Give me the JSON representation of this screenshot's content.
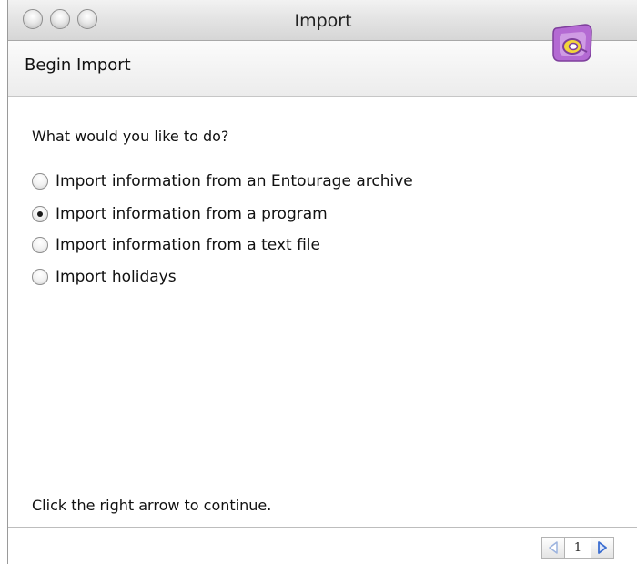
{
  "window": {
    "title": "Import"
  },
  "header": {
    "title": "Begin Import",
    "logo_icon": "entourage-logo-icon"
  },
  "content": {
    "question": "What would you like to do?",
    "options": [
      {
        "label": "Import information from an Entourage archive",
        "selected": false
      },
      {
        "label": "Import information from a program",
        "selected": true
      },
      {
        "label": "Import information from a text file",
        "selected": false
      },
      {
        "label": "Import holidays",
        "selected": false
      }
    ],
    "instruction": "Click the right arrow to continue."
  },
  "pager": {
    "current_page": "1",
    "prev_icon": "left-arrow-icon",
    "next_icon": "right-arrow-icon"
  },
  "colors": {
    "logo_purple": "#b46ad3",
    "logo_yellow": "#f2d53a",
    "arrow_blue": "#3d6fd1",
    "arrow_disabled": "#9cb3de"
  }
}
